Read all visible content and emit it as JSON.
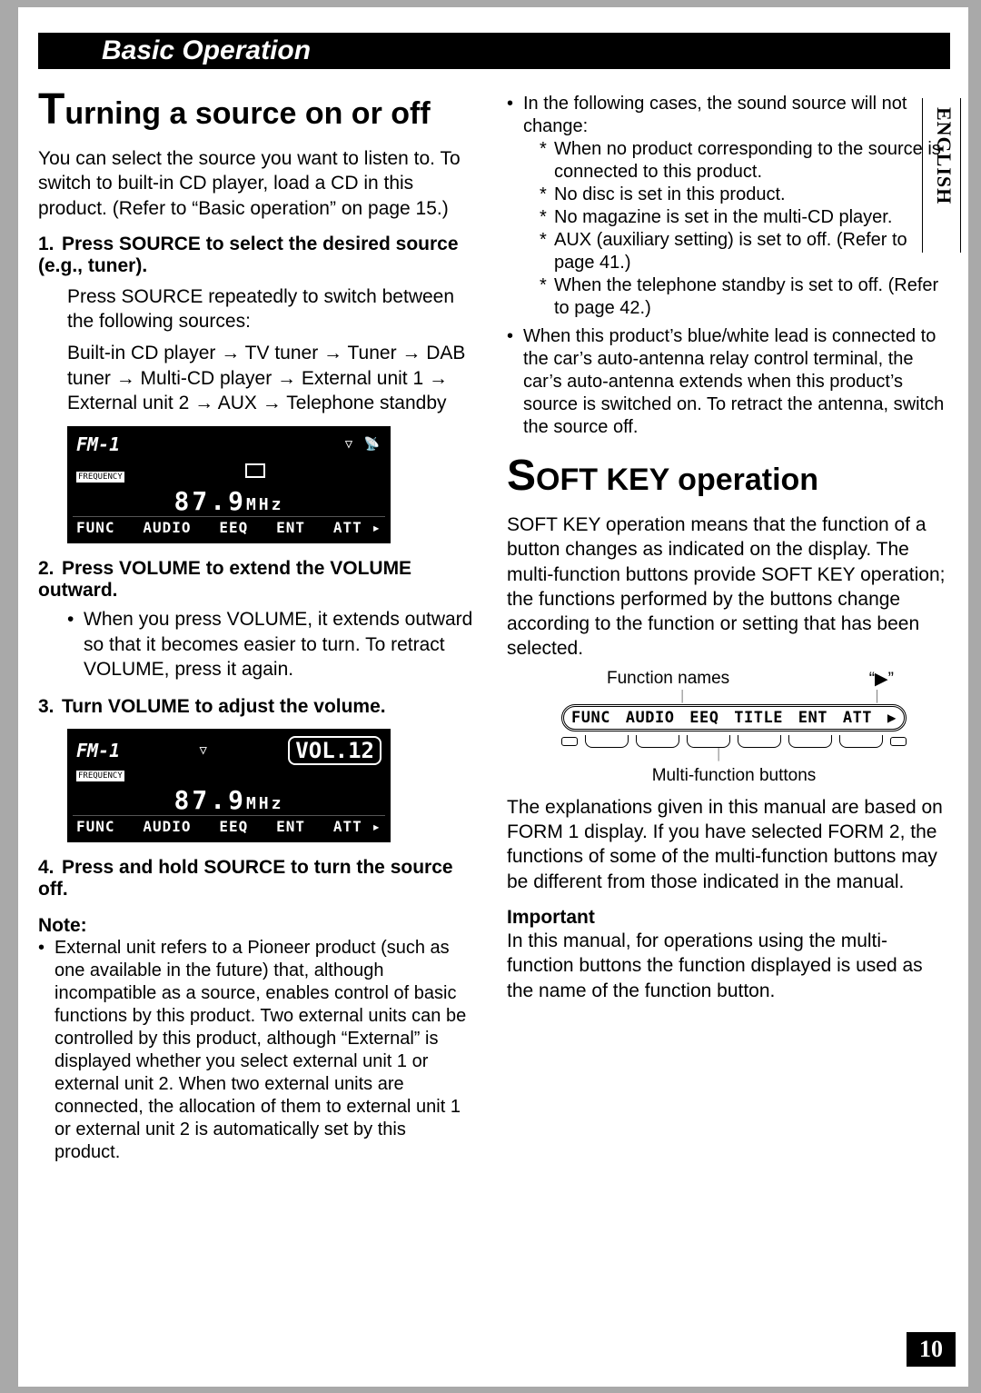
{
  "header": {
    "title": "Basic Operation"
  },
  "side_tab": "ENGLISH",
  "page_number": "10",
  "left": {
    "h2_cap": "T",
    "h2_rest": "urning a source on or off",
    "intro": "You can select the source you want to listen to. To switch to built-in CD player, load a CD in this product. (Refer to “Basic operation” on page 15.)",
    "steps": [
      {
        "num": "1.",
        "title": "Press SOURCE to select the desired source (e.g., tuner).",
        "sub_a": "Press SOURCE repeatedly to switch between the following sources:",
        "sub_b": "Built-in CD player → TV tuner → Tuner → DAB tuner → Multi-CD player → External unit 1 → External unit 2 → AUX → Telephone standby"
      },
      {
        "num": "2.",
        "title": "Press VOLUME to extend the VOLUME outward.",
        "bullet": "When you press VOLUME, it extends outward so that it becomes easier to turn. To retract VOLUME, press it again."
      },
      {
        "num": "3.",
        "title": "Turn VOLUME to adjust the volume."
      },
      {
        "num": "4.",
        "title": "Press and hold SOURCE to turn the source off."
      }
    ],
    "note_head": "Note:",
    "note_bullet": "External unit refers to a Pioneer product (such as one available in the future) that, although incompatible as a source, enables control of basic functions by this product. Two external units can be controlled by this product, although “External” is displayed whether you select external unit 1 or external unit 2. When two external units are connected, the allocation of them to external unit 1 or external unit 2 is automatically set by this product.",
    "lcd1": {
      "band": "FM-1",
      "freq_label": "FREQUENCY",
      "freq": "87.9",
      "unit": "MHz",
      "keys": [
        "FUNC",
        "AUDIO",
        "EEQ",
        "",
        "ENT",
        "ATT"
      ]
    },
    "lcd2": {
      "band": "FM-1",
      "vol": "VOL.12",
      "freq_label": "FREQUENCY",
      "freq": "87.9",
      "unit": "MHz",
      "keys": [
        "FUNC",
        "AUDIO",
        "EEQ",
        "",
        "ENT",
        "ATT"
      ]
    }
  },
  "right": {
    "top_bullets": [
      {
        "text": "In the following cases, the sound source will not change:",
        "sub": [
          "When no product corresponding to the source is connected to this product.",
          "No disc is set in this product.",
          "No magazine is set in the multi-CD player.",
          "AUX (auxiliary setting) is set to off. (Refer to page 41.)",
          "When the telephone standby is set to off. (Refer to page 42.)"
        ]
      },
      {
        "text": "When this product’s blue/white lead is connected to the car’s auto-antenna relay control terminal, the car’s auto-antenna extends when this product’s source is switched on. To retract the antenna, switch the source off."
      }
    ],
    "h2_cap": "S",
    "h2_rest": "OFT KEY operation",
    "p1": "SOFT KEY operation means that the function of a button changes as indicated on the display. The multi-function buttons provide SOFT KEY operation; the functions performed by the buttons change according to the function or setting that has been selected.",
    "diagram": {
      "label_left": "Function names",
      "label_right": "“▶”",
      "keys": [
        "FUNC",
        "AUDIO",
        "EEQ",
        "TITLE",
        "ENT",
        "ATT"
      ],
      "bottom_label": "Multi-function buttons"
    },
    "p2": "The explanations given in this manual are based on FORM 1 display. If you have selected FORM 2, the functions of some of the multi-function buttons may be different from those indicated in the manual.",
    "important_head": "Important",
    "p3": "In this manual, for operations using the multi-function buttons the function displayed is used as the name of the function button."
  }
}
